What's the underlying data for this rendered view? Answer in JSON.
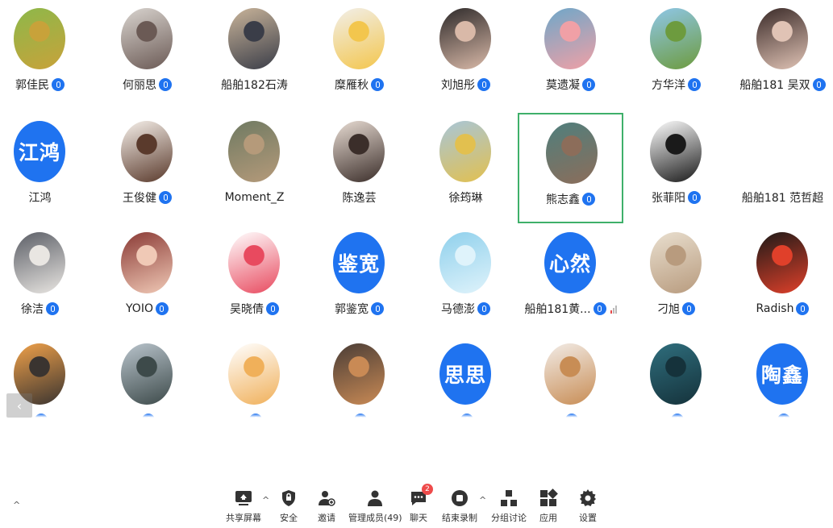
{
  "participants": [
    {
      "name": "郭佳民",
      "mic": true,
      "avatar": "photo-sunflowers",
      "colors": [
        "#8db84a",
        "#c8a23a"
      ]
    },
    {
      "name": "何丽思",
      "mic": true,
      "avatar": "photo-girl-reading",
      "colors": [
        "#d9d4cf",
        "#6b5a55"
      ]
    },
    {
      "name": "船舶182石涛",
      "mic": false,
      "avatar": "photo-person-beach",
      "colors": [
        "#c9b49a",
        "#3a3d48"
      ]
    },
    {
      "name": "糜雁秋",
      "mic": true,
      "avatar": "cartoon-boy-yellow-hat",
      "colors": [
        "#f2efe9",
        "#f3c64d"
      ]
    },
    {
      "name": "刘旭彤",
      "mic": true,
      "avatar": "photo-woman-dark",
      "colors": [
        "#2e2a2a",
        "#d9b9a8"
      ]
    },
    {
      "name": "莫遗凝",
      "mic": true,
      "avatar": "cartoon-patrick",
      "colors": [
        "#6ea7c9",
        "#f0a0a6"
      ]
    },
    {
      "name": "方华洋",
      "mic": true,
      "avatar": "cartoon-green-character",
      "colors": [
        "#8fc7e8",
        "#6d9b3e"
      ]
    },
    {
      "name": "船舶181 吴双",
      "mic": true,
      "avatar": "photo-woman-long-hair",
      "colors": [
        "#3a2a28",
        "#e0c3b5"
      ]
    },
    {
      "name": "江鸿",
      "mic": false,
      "avatar_text": "江鸿"
    },
    {
      "name": "王俊健",
      "mic": true,
      "avatar": "cartoon-girl-doll",
      "colors": [
        "#f6f0ea",
        "#5a3a2c"
      ]
    },
    {
      "name": "Moment_Z",
      "mic": false,
      "avatar": "photo-animal-texture",
      "colors": [
        "#6f7a62",
        "#b59a7a"
      ]
    },
    {
      "name": "陈逸芸",
      "mic": false,
      "avatar": "photo-girl-selfie",
      "colors": [
        "#e8dcd3",
        "#3b2e2a"
      ]
    },
    {
      "name": "徐筠琳",
      "mic": false,
      "avatar": "anime-sunflowers",
      "colors": [
        "#a8c6d8",
        "#e2c04f"
      ]
    },
    {
      "name": "熊志鑫",
      "mic": true,
      "avatar": "photo-landscape-teal",
      "colors": [
        "#4f7f7d",
        "#8c6d5a"
      ],
      "active": true
    },
    {
      "name": "张菲阳",
      "mic": true,
      "avatar": "cartoon-boy-mask",
      "colors": [
        "#ffffff",
        "#1a1a1a"
      ]
    },
    {
      "name": "船舶181 范哲超",
      "mic": false,
      "avatar": "none"
    },
    {
      "name": "徐洁",
      "mic": true,
      "avatar": "photo-cat",
      "colors": [
        "#5b5e66",
        "#e9e6e2"
      ]
    },
    {
      "name": "YOIO",
      "mic": true,
      "avatar": "photo-child",
      "colors": [
        "#8a3a35",
        "#f0c9b6"
      ]
    },
    {
      "name": "吴晓倩",
      "mic": true,
      "avatar": "cartoon-girl-red",
      "colors": [
        "#ffffff",
        "#e84a5f"
      ]
    },
    {
      "name": "郭鉴宽",
      "mic": true,
      "avatar_text": "鉴宽"
    },
    {
      "name": "马德澎",
      "mic": true,
      "avatar": "anime-sky-boy",
      "colors": [
        "#8fd0ec",
        "#dff3fb"
      ]
    },
    {
      "name": "船舶181黄...",
      "mic": true,
      "avatar_text": "心然",
      "signal": true
    },
    {
      "name": "刁旭",
      "mic": true,
      "avatar": "photo-plush-dog",
      "colors": [
        "#e9dfcf",
        "#b89b7e"
      ]
    },
    {
      "name": "Radish",
      "mic": true,
      "avatar": "cartoon-red-flame",
      "colors": [
        "#1d1a18",
        "#e0402a"
      ]
    },
    {
      "name": "",
      "mic": false,
      "avatar": "photo-street-dusk",
      "colors": [
        "#f0a14a",
        "#3a3430"
      ]
    },
    {
      "name": "",
      "mic": false,
      "avatar": "photo-buildings",
      "colors": [
        "#b9c4cc",
        "#3d4a4a"
      ]
    },
    {
      "name": "",
      "mic": false,
      "avatar": "cartoon-shiba",
      "colors": [
        "#ffffff",
        "#f0b05a"
      ]
    },
    {
      "name": "",
      "mic": false,
      "avatar": "photo-shiba-dog",
      "colors": [
        "#4a3d36",
        "#c98a55"
      ]
    },
    {
      "name": "",
      "mic": false,
      "avatar_text": "思思"
    },
    {
      "name": "",
      "mic": false,
      "avatar": "photo-puppy",
      "colors": [
        "#f2ece7",
        "#c88d55"
      ]
    },
    {
      "name": "",
      "mic": false,
      "avatar": "photo-teal-leaves",
      "colors": [
        "#2f6e7d",
        "#15323b"
      ]
    },
    {
      "name": "",
      "mic": false,
      "avatar_text": "陶鑫"
    }
  ],
  "toolbar": {
    "share": "共享屏幕",
    "security": "安全",
    "invite": "邀请",
    "manage": "管理成员(49)",
    "chat": "聊天",
    "chat_badge": "2",
    "record": "结束录制",
    "breakout": "分组讨论",
    "apps": "应用",
    "settings": "设置",
    "left_caret": "^",
    "share_caret": "^",
    "record_caret": "^",
    "left_tab": "‹"
  }
}
